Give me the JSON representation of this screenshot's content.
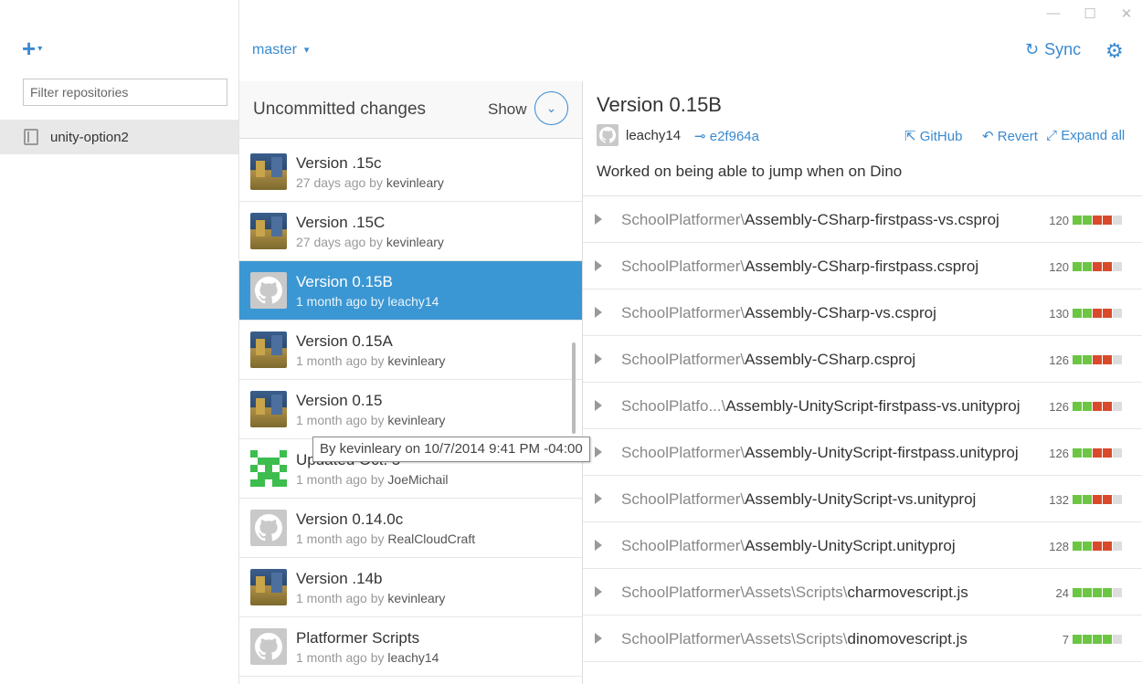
{
  "window": {
    "minimize": "—",
    "maximize": "☐",
    "close": "✕"
  },
  "sidebar": {
    "add_icon": "+",
    "add_caret": "▾",
    "filter_placeholder": "Filter repositories",
    "repos": [
      {
        "label": "unity-option2"
      }
    ]
  },
  "branch": {
    "label": "master",
    "caret": "▾"
  },
  "toolbar": {
    "sync_label": "Sync",
    "sync_icon": "↻",
    "gear_icon": "⚙"
  },
  "uncommitted": {
    "title": "Uncommitted changes",
    "show_label": "Show",
    "show_icon": "⌄"
  },
  "commits": [
    {
      "title": "Version .15c",
      "time": "27 days ago by",
      "author": "kevinleary",
      "avatar": "unity"
    },
    {
      "title": "Version .15C",
      "time": "27 days ago by",
      "author": "kevinleary",
      "avatar": "unity"
    },
    {
      "title": "Version 0.15B",
      "time": "1 month ago by",
      "author": "leachy14",
      "avatar": "github",
      "selected": true
    },
    {
      "title": "Version 0.15A",
      "time": "1 month ago by",
      "author": "kevinleary",
      "avatar": "unity"
    },
    {
      "title": "Version 0.15",
      "time": "1 month ago by",
      "author": "kevinleary",
      "avatar": "unity"
    },
    {
      "title": "Updated Oct. 5",
      "time": "1 month ago by",
      "author": "JoeMichail",
      "avatar": "pixel"
    },
    {
      "title": "Version 0.14.0c",
      "time": "1 month ago by",
      "author": "RealCloudCraft",
      "avatar": "github"
    },
    {
      "title": "Version .14b",
      "time": "1 month ago by",
      "author": "kevinleary",
      "avatar": "unity"
    },
    {
      "title": "Platformer Scripts",
      "time": "1 month ago by",
      "author": "leachy14",
      "avatar": "github"
    }
  ],
  "tooltip": "By kevinleary on 10/7/2014 9:41 PM -04:00",
  "detail": {
    "title": "Version 0.15B",
    "author": "leachy14",
    "sha": "e2f964a",
    "sha_icon": "⊸",
    "github_label": "GitHub",
    "github_icon": "⇱",
    "revert_label": "Revert",
    "revert_icon": "↶",
    "expand_label": "Expand all",
    "expand_icon": "⤢",
    "message": "Worked on being able to jump when on Dino"
  },
  "files": [
    {
      "dir": "SchoolPlatformer\\",
      "name": "Assembly-CSharp-firstpass-vs.csproj",
      "count": "120",
      "bars": "ggrrn"
    },
    {
      "dir": "SchoolPlatformer\\",
      "name": "Assembly-CSharp-firstpass.csproj",
      "count": "120",
      "bars": "ggrrn"
    },
    {
      "dir": "SchoolPlatformer\\",
      "name": "Assembly-CSharp-vs.csproj",
      "count": "130",
      "bars": "ggrrn"
    },
    {
      "dir": "SchoolPlatformer\\",
      "name": "Assembly-CSharp.csproj",
      "count": "126",
      "bars": "ggrrn"
    },
    {
      "dir": "SchoolPlatfo...\\",
      "name": "Assembly-UnityScript-firstpass-vs.unityproj",
      "count": "126",
      "bars": "ggrrn"
    },
    {
      "dir": "SchoolPlatformer\\",
      "name": "Assembly-UnityScript-firstpass.unityproj",
      "count": "126",
      "bars": "ggrrn"
    },
    {
      "dir": "SchoolPlatformer\\",
      "name": "Assembly-UnityScript-vs.unityproj",
      "count": "132",
      "bars": "ggrrn"
    },
    {
      "dir": "SchoolPlatformer\\",
      "name": "Assembly-UnityScript.unityproj",
      "count": "128",
      "bars": "ggrrn"
    },
    {
      "dir": "SchoolPlatformer\\Assets\\Scripts\\",
      "name": "charmovescript.js",
      "count": "24",
      "bars": "ggggn"
    },
    {
      "dir": "SchoolPlatformer\\Assets\\Scripts\\",
      "name": "dinomovescript.js",
      "count": "7",
      "bars": "ggggn"
    }
  ]
}
